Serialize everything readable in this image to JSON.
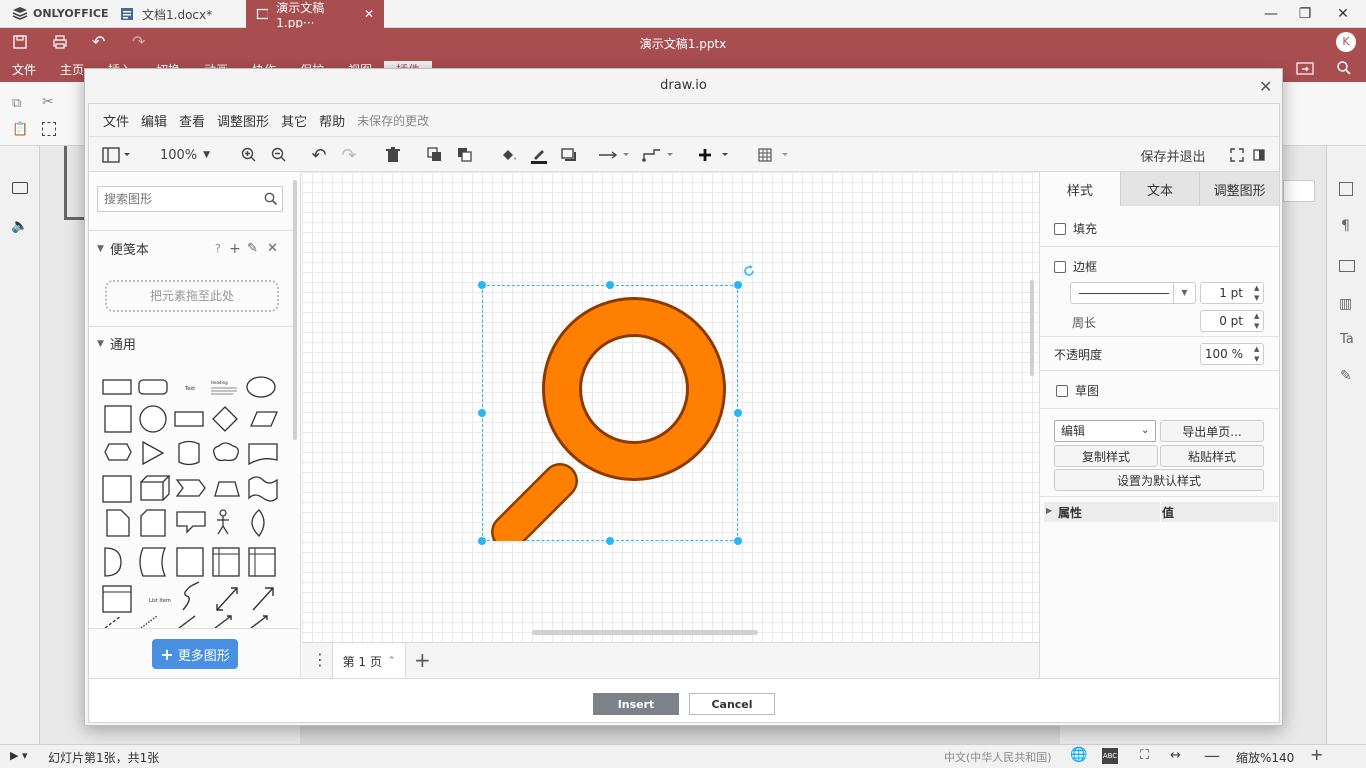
{
  "app": {
    "brand": "ONLYOFFICE"
  },
  "tabs": [
    {
      "label": "文档1.docx*"
    },
    {
      "label": "演示文稿1.pp···"
    }
  ],
  "window": {
    "minimize": "—",
    "maximize": "❐",
    "close": "✕"
  },
  "header": {
    "doc_title": "演示文稿1.pptx",
    "user_initial": "K"
  },
  "ribbon_tabs": [
    "文件",
    "主页",
    "插入",
    "切换",
    "动画",
    "协作",
    "保护",
    "视图",
    "插件"
  ],
  "dialog": {
    "title": "draw.io",
    "menu": [
      "文件",
      "编辑",
      "查看",
      "调整图形",
      "其它",
      "帮助"
    ],
    "unsaved": "未保存的更改",
    "zoom": "100%",
    "save_exit": "保存并退出",
    "search_placeholder": "搜索图形",
    "scratchpad": {
      "title": "便笺本",
      "help": "?",
      "drop_hint": "把元素拖至此处"
    },
    "general": {
      "title": "通用"
    },
    "more_shapes": "更多图形",
    "page_tab": "第 1 页",
    "format_tabs": [
      "样式",
      "文本",
      "调整图形"
    ],
    "fill_label": "填充",
    "border_label": "边框",
    "border_width": "1 pt",
    "perimeter_label": "周长",
    "perimeter_value": "0 pt",
    "opacity_label": "不透明度",
    "opacity_value": "100 %",
    "sketch_label": "草图",
    "edit_select": "编辑",
    "export_page": "导出单页...",
    "copy_style": "复制样式",
    "paste_style": "粘贴样式",
    "set_default": "设置为默认样式",
    "props_header": "属性",
    "value_header": "值",
    "insert": "Insert",
    "cancel": "Cancel",
    "shape_fill": "#ff7f00",
    "shape_stroke": "#8c3a00"
  },
  "status": {
    "slide_info": "幻灯片第1张，共1张",
    "language": "中文(中华人民共和国)",
    "zoom": "缩放%140"
  },
  "colors": {
    "brand": "#a94e50",
    "accent": "#29b6f2",
    "more_button": "#4a90e2"
  }
}
